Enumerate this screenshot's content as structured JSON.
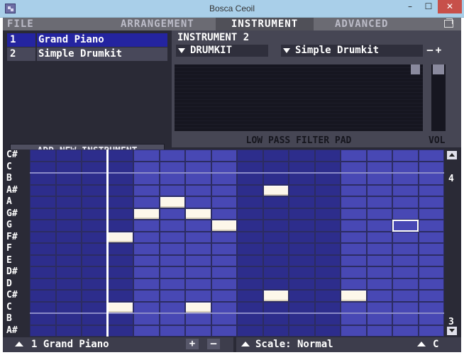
{
  "window": {
    "title": "Bosca Ceoil",
    "min_glyph": "–",
    "max_glyph": "☐",
    "close_glyph": "✕"
  },
  "menu": {
    "file": "FILE",
    "arrangement": "ARRANGEMENT",
    "instrument": "INSTRUMENT",
    "advanced": "ADVANCED",
    "restore_icon": "restore-icon"
  },
  "instruments": [
    {
      "num": "1",
      "name": "Grand Piano",
      "selected": true
    },
    {
      "num": "2",
      "name": "Simple Drumkit",
      "selected": false
    }
  ],
  "add_instrument_label": "ADD NEW INSTRUMENT",
  "editor": {
    "title": "INSTRUMENT 2",
    "type": "DRUMKIT",
    "voice": "Simple Drumkit",
    "prev_glyph": "–",
    "next_glyph": "+",
    "filter_label": "LOW PASS FILTER PAD",
    "vol_label": "VOL"
  },
  "keys": [
    "C#",
    "C",
    "B",
    "A#",
    "A",
    "G#",
    "G",
    "F#",
    "F",
    "E",
    "D#",
    "D",
    "C#",
    "C",
    "B",
    "A#"
  ],
  "scroll": {
    "octave_top": "4",
    "octave_bottom": "3"
  },
  "grid": {
    "columns": 16,
    "rows": 16,
    "notes": [
      {
        "col": 3,
        "row": 7
      },
      {
        "col": 3,
        "row": 13
      },
      {
        "col": 4,
        "row": 5
      },
      {
        "col": 5,
        "row": 4
      },
      {
        "col": 6,
        "row": 5
      },
      {
        "col": 6,
        "row": 13
      },
      {
        "col": 7,
        "row": 6
      },
      {
        "col": 9,
        "row": 3
      },
      {
        "col": 9,
        "row": 12
      },
      {
        "col": 12,
        "row": 12
      }
    ],
    "cursor": {
      "col": 14,
      "row": 6
    },
    "playhead_col": 3,
    "colors": {
      "dark": "#2d2d8c",
      "light": "#4848b4",
      "note": "#fdf7ea"
    }
  },
  "bottom": {
    "instrument_label": "1  Grand Piano",
    "plus": "+",
    "minus": "–",
    "scale_label": "Scale: Normal",
    "key_label": "C"
  }
}
